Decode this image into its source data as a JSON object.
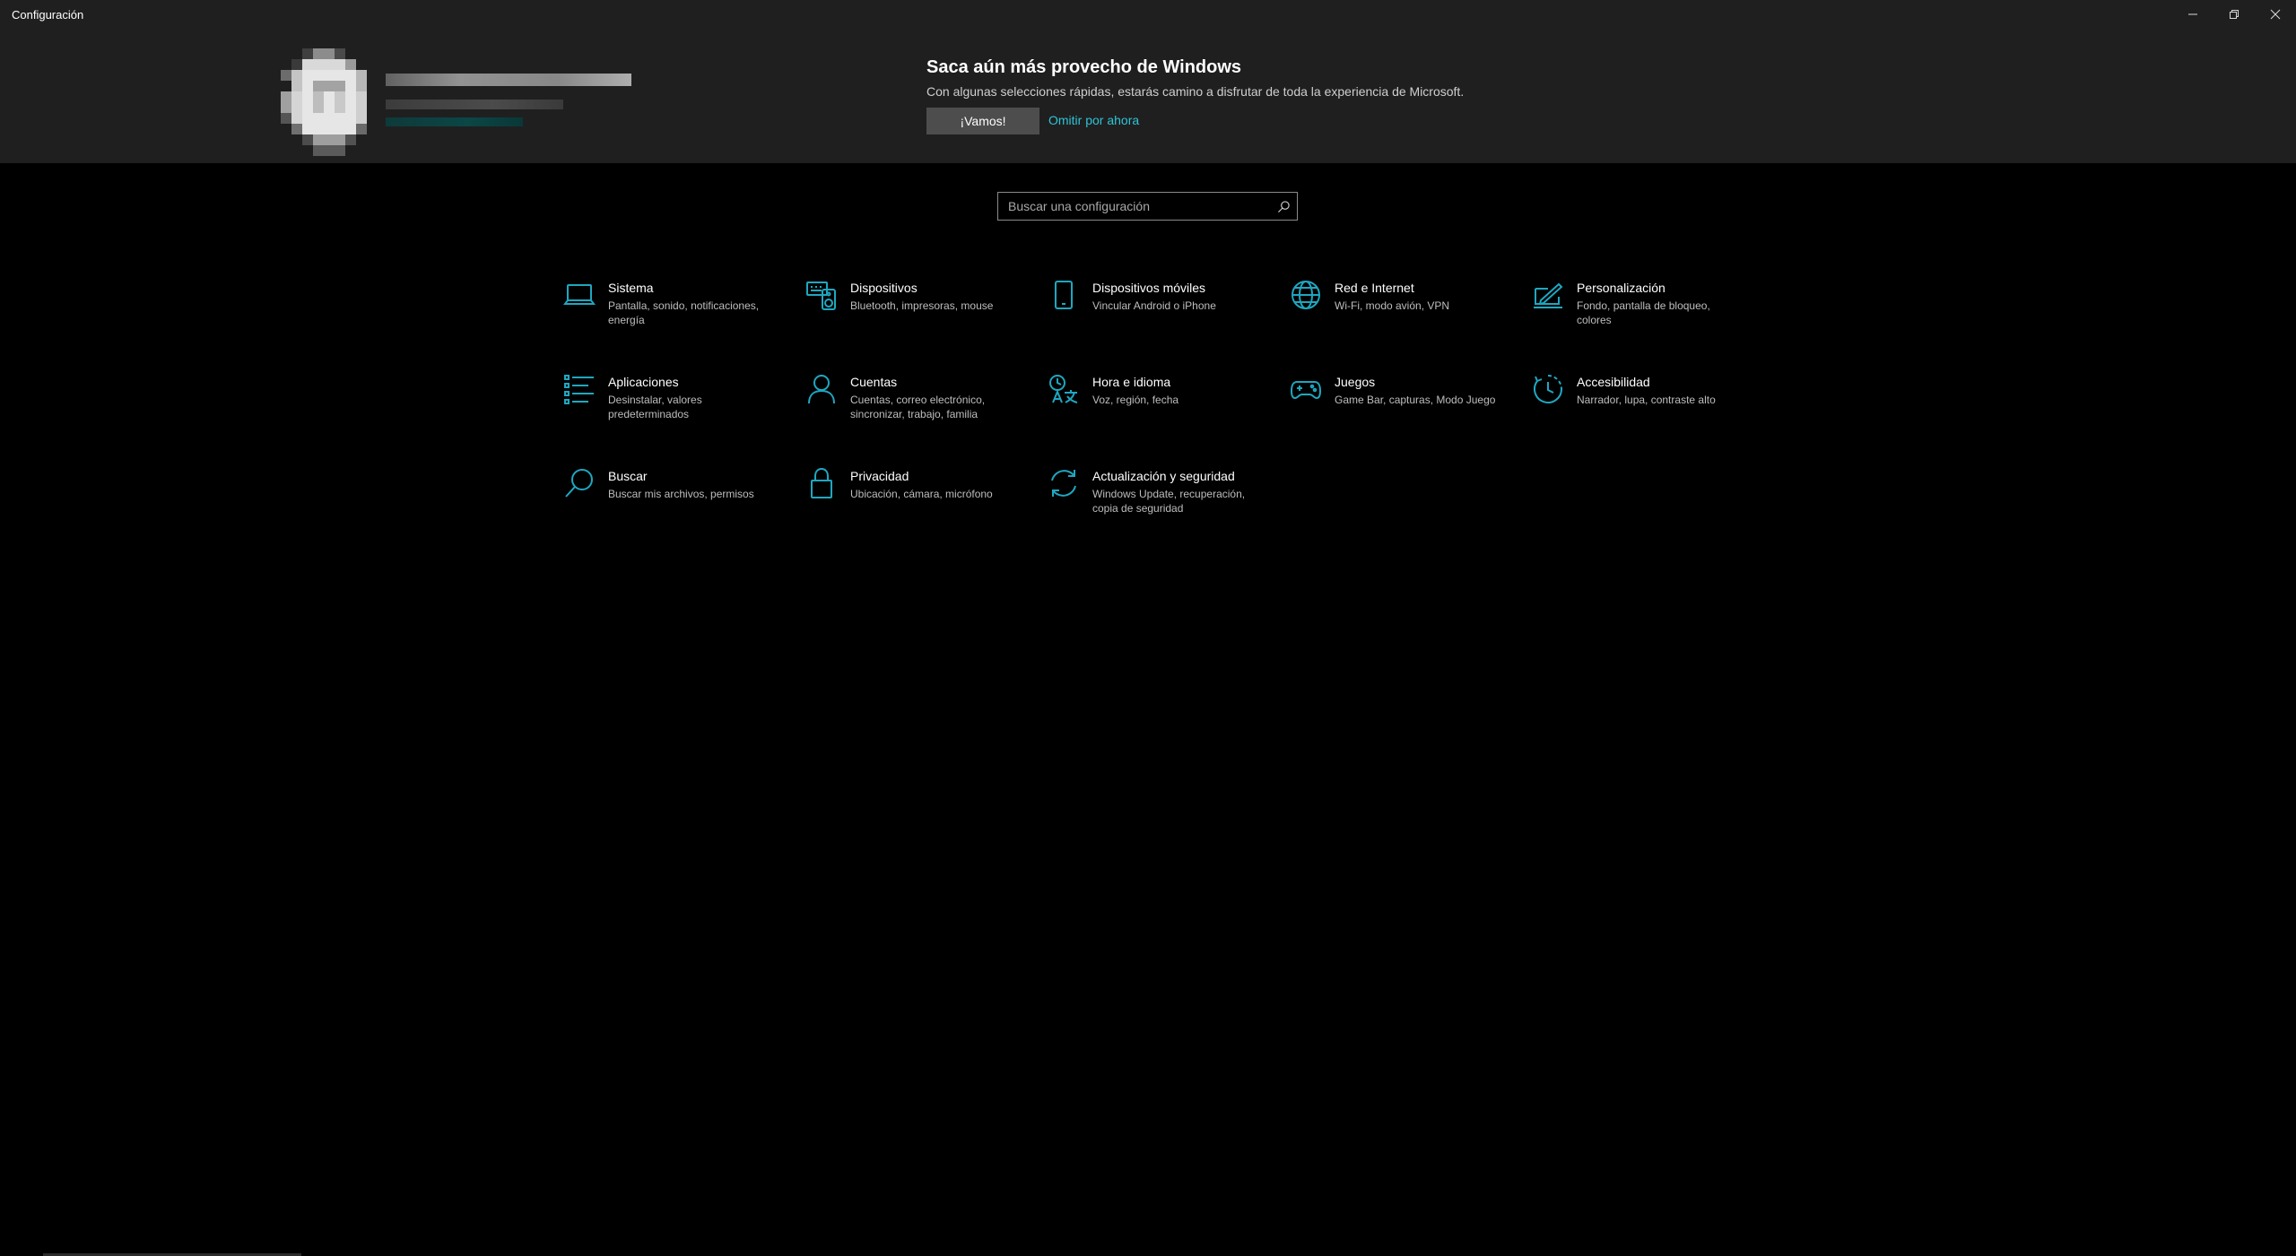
{
  "window": {
    "title": "Configuración"
  },
  "banner": {
    "title": "Saca aún más provecho de Windows",
    "description": "Con algunas selecciones rápidas, estarás camino a disfrutar de toda la experiencia de Microsoft.",
    "primary_label": "¡Vamos!",
    "skip_label": "Omitir por ahora"
  },
  "search": {
    "placeholder": "Buscar una configuración"
  },
  "colors": {
    "accent": "#1ea7c0",
    "link": "#2ec4d6",
    "background": "#000000",
    "header": "#1f1f1f"
  },
  "categories": [
    {
      "name": "Sistema",
      "desc": "Pantalla, sonido, notificaciones, energía",
      "icon": "laptop-icon"
    },
    {
      "name": "Dispositivos",
      "desc": "Bluetooth, impresoras, mouse",
      "icon": "keyboard-speaker-icon"
    },
    {
      "name": "Dispositivos móviles",
      "desc": "Vincular Android o iPhone",
      "icon": "phone-icon"
    },
    {
      "name": "Red e Internet",
      "desc": "Wi-Fi, modo avión, VPN",
      "icon": "globe-icon"
    },
    {
      "name": "Personalización",
      "desc": "Fondo, pantalla de bloqueo, colores",
      "icon": "pen-tablet-icon"
    },
    {
      "name": "Aplicaciones",
      "desc": "Desinstalar, valores predeterminados",
      "icon": "list-icon"
    },
    {
      "name": "Cuentas",
      "desc": "Cuentas, correo electrónico, sincronizar, trabajo, familia",
      "icon": "person-icon"
    },
    {
      "name": "Hora e idioma",
      "desc": "Voz, región, fecha",
      "icon": "clock-language-icon"
    },
    {
      "name": "Juegos",
      "desc": "Game Bar, capturas, Modo Juego",
      "icon": "gamepad-icon"
    },
    {
      "name": "Accesibilidad",
      "desc": "Narrador, lupa, contraste alto",
      "icon": "accessibility-icon"
    },
    {
      "name": "Buscar",
      "desc": "Buscar mis archivos, permisos",
      "icon": "search-icon"
    },
    {
      "name": "Privacidad",
      "desc": "Ubicación, cámara, micrófono",
      "icon": "lock-icon"
    },
    {
      "name": "Actualización y seguridad",
      "desc": "Windows Update, recuperación, copia de seguridad",
      "icon": "sync-icon"
    }
  ]
}
